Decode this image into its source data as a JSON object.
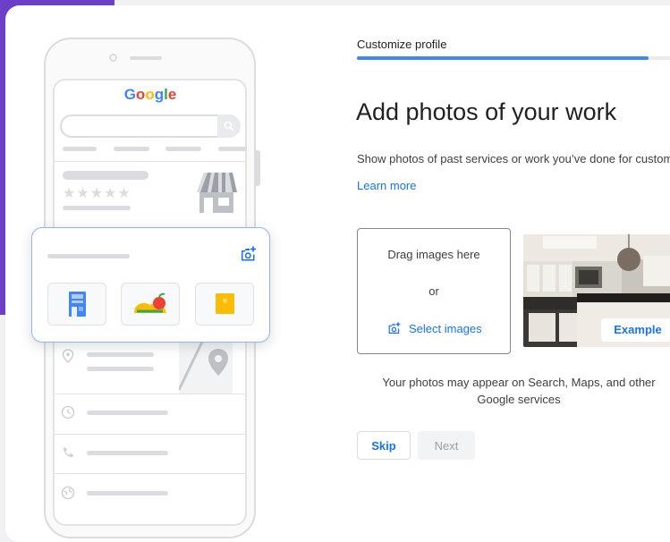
{
  "header": {
    "step_label": "Customize profile",
    "progress": 0.93
  },
  "main": {
    "heading": "Add photos of your work",
    "description": "Show photos of past services or work you’ve done for customers.",
    "learn_more": "Learn more",
    "dropzone": {
      "drag_text": "Drag images here",
      "or_text": "or",
      "select_label": "Select images"
    },
    "example_label": "Example",
    "notice": "Your photos may appear on Search, Maps, and other Google services",
    "buttons": {
      "skip": "Skip",
      "next": "Next"
    }
  },
  "illustration": {
    "logo_letters": [
      "G",
      "o",
      "o",
      "g",
      "l",
      "e"
    ],
    "logo_colors": [
      "#4285f4",
      "#ea4335",
      "#fbbc05",
      "#4285f4",
      "#34a853",
      "#ea4335"
    ],
    "stars": "★★★★★"
  },
  "colors": {
    "accent": "#1a73e8",
    "brand_purple": "#6c3fc7",
    "progress": "#4285f4"
  }
}
